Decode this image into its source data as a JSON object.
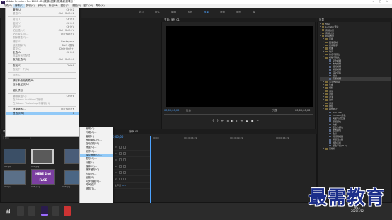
{
  "window": {
    "title": "Adobe Premiere Pro 2020 - D:\\視頻\\\\視頻\\\\視頻\\新建項目 *",
    "logo": "Pr"
  },
  "menubar": [
    "文件(F)",
    "编辑(E)",
    "剪辑(C)",
    "序列(S)",
    "标记(M)",
    "图形(G)",
    "视图(V)",
    "窗口(W)",
    "帮助(H)"
  ],
  "workspace_tabs": [
    "学习",
    "组件",
    "编辑",
    "颜色",
    "效果",
    "音频",
    "图形",
    "库"
  ],
  "active_workspace": "效果",
  "edit_menu": [
    {
      "label": "撤消(U)",
      "shortcut": "Ctrl+Z",
      "disabled": false
    },
    {
      "label": "重做(R)",
      "shortcut": "Ctrl+Shift+Z",
      "disabled": true
    },
    {
      "sep": true
    },
    {
      "label": "剪切(T)",
      "shortcut": "Ctrl+X",
      "disabled": true
    },
    {
      "label": "复制(Y)",
      "shortcut": "Ctrl+C",
      "disabled": true
    },
    {
      "label": "粘贴(P)",
      "shortcut": "Ctrl+V",
      "disabled": true
    },
    {
      "label": "粘贴插入(I)",
      "shortcut": "Ctrl+Shift+V",
      "disabled": true
    },
    {
      "label": "粘贴属性(B)...",
      "shortcut": "Ctrl+Alt+V",
      "disabled": true
    },
    {
      "label": "删除属性(R)...",
      "shortcut": "",
      "disabled": true
    },
    {
      "label": "清除(E)",
      "shortcut": "Backspace",
      "disabled": true
    },
    {
      "label": "波纹删除(T)",
      "shortcut": "Shift+删除",
      "disabled": true
    },
    {
      "label": "重复(C)",
      "shortcut": "Ctrl+Shift+/",
      "disabled": true
    },
    {
      "label": "全选(A)",
      "shortcut": "Ctrl+A",
      "disabled": false
    },
    {
      "label": "选择所有匹配项",
      "shortcut": "",
      "disabled": true
    },
    {
      "label": "取消全选(D)",
      "shortcut": "Ctrl+Shift+A",
      "disabled": false
    },
    {
      "sep": true
    },
    {
      "label": "查找(F)...",
      "shortcut": "Ctrl+F",
      "disabled": false
    },
    {
      "label": "查找下一个(N)",
      "shortcut": "",
      "disabled": true
    },
    {
      "sep": true
    },
    {
      "label": "标签(L)",
      "shortcut": "",
      "disabled": true
    },
    {
      "sep": true
    },
    {
      "label": "移除未使用资源(R)",
      "shortcut": "",
      "disabled": false
    },
    {
      "label": "合并重复项(C)",
      "shortcut": "",
      "disabled": false
    },
    {
      "sep": true
    },
    {
      "label": "团队项目",
      "shortcut": "",
      "disabled": false
    },
    {
      "sep": true
    },
    {
      "label": "编辑原始(O)",
      "shortcut": "Ctrl+E",
      "disabled": true
    },
    {
      "label": "在 Adobe Audition 中编辑",
      "shortcut": "",
      "disabled": true
    },
    {
      "label": "在 Adobe Photoshop 中编辑(H)",
      "shortcut": "",
      "disabled": true
    },
    {
      "sep": true
    },
    {
      "label": "快捷键(K)...",
      "shortcut": "Ctrl+Alt+K",
      "disabled": false
    },
    {
      "label": "首选项(N)",
      "shortcut": "",
      "disabled": false,
      "highlighted": true
    }
  ],
  "prefs_submenu": [
    "常规(G)...",
    "外观(A)...",
    "音频(U)...",
    "音频硬件(H)...",
    "自动保存(S)...",
    "捕捉(C)...",
    "协作(C)...",
    "操控面板(O)...",
    "图形(G)...",
    "标签(L)...",
    "媒体(M)...",
    "媒体缓存(C)...",
    "内存(R)...",
    "回放(P)...",
    "同步设置(S)...",
    "时间轴(T)...",
    "修剪(T)..."
  ],
  "prefs_submenu_highlighted": "操控面板(O)...",
  "program_monitor": {
    "title": "节目: 序列 01",
    "tc_left": "00;00;00;00",
    "fit": "适合",
    "full": "完整",
    "tc_right": "00;00;00;00"
  },
  "effects_panel": {
    "title": "效果",
    "items": [
      {
        "label": "预设",
        "depth": 0,
        "open": false
      },
      {
        "label": "Lumetri 预设",
        "depth": 0,
        "open": false
      },
      {
        "label": "音频效果",
        "depth": 0,
        "open": false
      },
      {
        "label": "音频过渡",
        "depth": 0,
        "open": false
      },
      {
        "label": "视频效果",
        "depth": 0,
        "open": true
      },
      {
        "label": "变换",
        "depth": 1,
        "open": false
      },
      {
        "label": "图像控制",
        "depth": 1,
        "open": false
      },
      {
        "label": "实用程序",
        "depth": 1,
        "open": false
      },
      {
        "label": "扭曲",
        "depth": 1,
        "open": false
      },
      {
        "label": "时间",
        "depth": 1,
        "open": false
      },
      {
        "label": "杂色与颗粒",
        "depth": 1,
        "open": false
      },
      {
        "label": "模糊与锐化",
        "depth": 1,
        "open": true
      },
      {
        "label": "复合模糊",
        "depth": 2,
        "open": false
      },
      {
        "label": "方向模糊",
        "depth": 2,
        "open": false
      },
      {
        "label": "相机模糊",
        "depth": 2,
        "open": false
      },
      {
        "label": "通道模糊",
        "depth": 2,
        "open": false
      },
      {
        "label": "钝化蒙版",
        "depth": 2,
        "open": false
      },
      {
        "label": "锐化",
        "depth": 2,
        "open": false
      },
      {
        "label": "高斯模糊",
        "depth": 2,
        "open": false,
        "selected": true
      },
      {
        "label": "沉浸式视频",
        "depth": 1,
        "open": false
      },
      {
        "label": "生成",
        "depth": 1,
        "open": false
      },
      {
        "label": "视频",
        "depth": 1,
        "open": false
      },
      {
        "label": "调整",
        "depth": 1,
        "open": false
      },
      {
        "label": "过时",
        "depth": 1,
        "open": false
      },
      {
        "label": "过渡",
        "depth": 1,
        "open": false
      },
      {
        "label": "透视",
        "depth": 1,
        "open": false
      },
      {
        "label": "通道",
        "depth": 1,
        "open": false
      },
      {
        "label": "键控",
        "depth": 1,
        "open": false
      },
      {
        "label": "颜色校正",
        "depth": 1,
        "open": true
      },
      {
        "label": "ASC CDL",
        "depth": 2,
        "open": false
      },
      {
        "label": "Lumetri 颜色",
        "depth": 2,
        "open": false
      },
      {
        "label": "亮度与对比度",
        "depth": 2,
        "open": false
      },
      {
        "label": "保留颜色",
        "depth": 2,
        "open": false
      },
      {
        "label": "均衡",
        "depth": 2,
        "open": false
      },
      {
        "label": "更改为颜色",
        "depth": 2,
        "open": false
      },
      {
        "label": "更改颜色",
        "depth": 2,
        "open": false
      },
      {
        "label": "色彩",
        "depth": 2,
        "open": false
      },
      {
        "label": "视频限幅器",
        "depth": 2,
        "open": false
      },
      {
        "label": "通道混合器",
        "depth": 2,
        "open": false
      },
      {
        "label": "颜色平衡",
        "depth": 2,
        "open": false
      },
      {
        "label": "颜色平衡(HLS)",
        "depth": 2,
        "open": false
      },
      {
        "label": "风格化",
        "depth": 1,
        "open": false
      }
    ]
  },
  "project_panel": {
    "title": "项目: 新建项目",
    "search_placeholder": "搜索",
    "thumb_labels": [
      "001.jpg",
      "002.jpg",
      "003.jpg",
      "004.jpg",
      "005.png",
      "006.jpg"
    ],
    "title_card": "HEBE 2nd FACE"
  },
  "timeline": {
    "tab": "序列 01",
    "timecode": "00;00;00;00",
    "ruler": [
      "00;00",
      "00;00;04;29",
      "00;00;09;29",
      "00;00;14;29"
    ],
    "tracks": [
      "V3",
      "V2",
      "V1",
      "A1",
      "A2",
      "A3",
      "主声道"
    ],
    "master_value": "0.0"
  },
  "taskbar": {
    "time": "9:11",
    "date": "2021/7/12"
  },
  "watermark": "最需教育",
  "colors": {
    "accent": "#4da3ff",
    "menu_highlight": "#91c9f7",
    "watermark": "#1c2e8a"
  }
}
